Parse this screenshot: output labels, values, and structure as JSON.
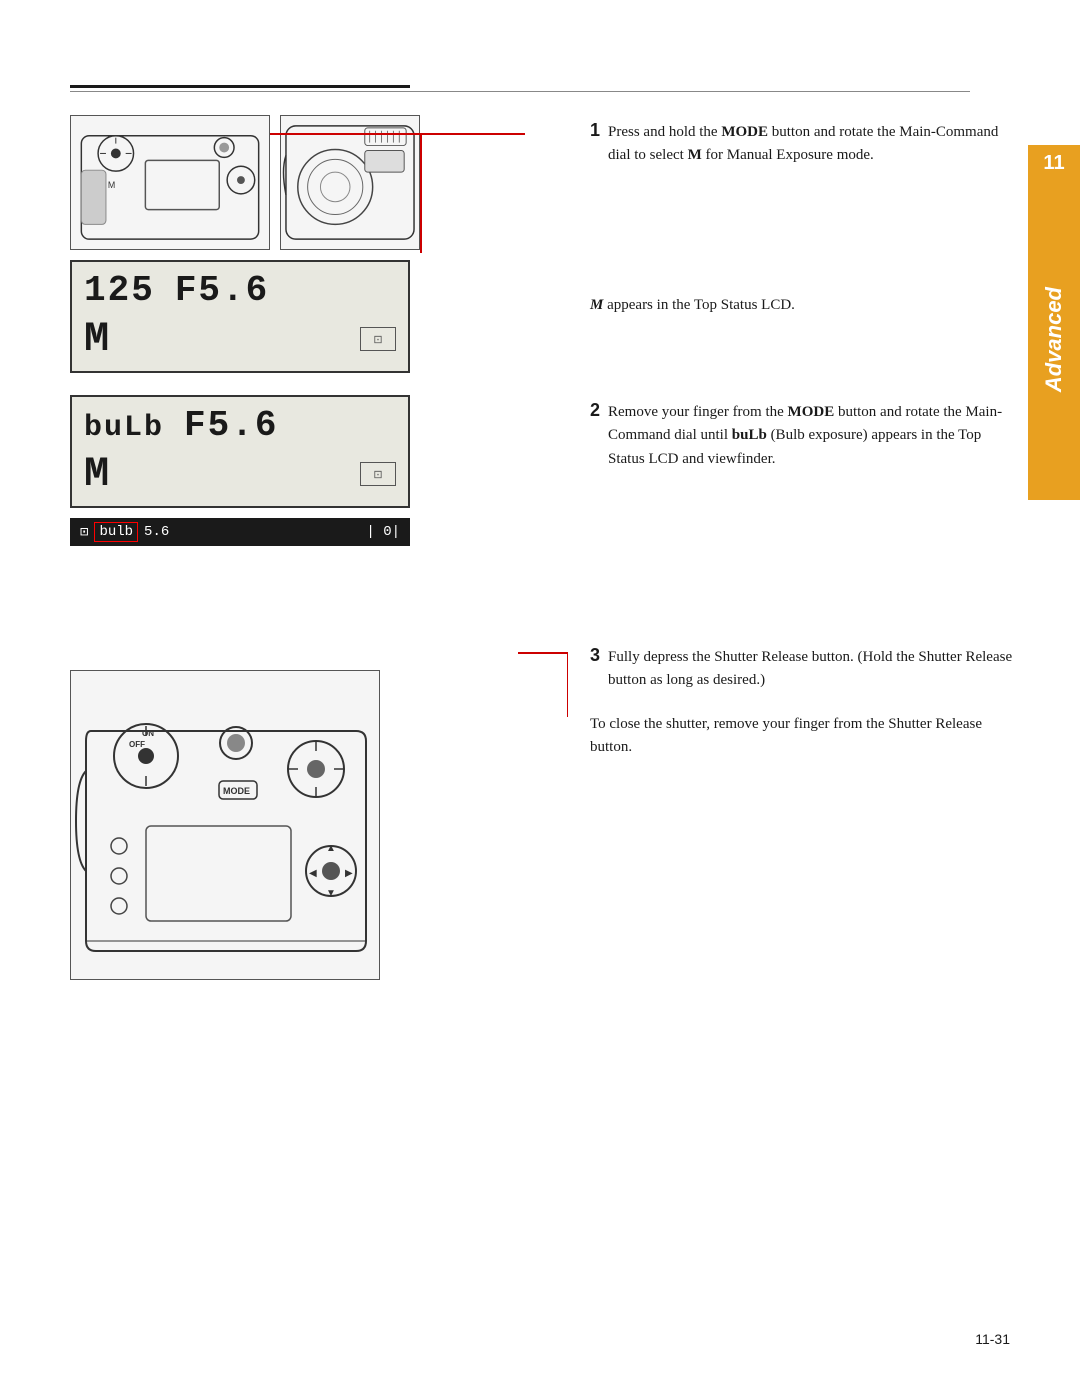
{
  "page": {
    "number": "11-31",
    "chapter_number": "11",
    "chapter_label": "Advanced"
  },
  "step1": {
    "number": "1",
    "text_line1": "Press and hold the ",
    "text_bold1": "MODE",
    "text_line2": "button and rotate the Main-Command dial to select ",
    "text_bold2": "M",
    "text_line3": " for Manual Exposure mode.",
    "lcd_note_italic": "M",
    "lcd_note_rest": " appears in the Top Status LCD.",
    "lcd_top_left": "125",
    "lcd_top_right": "F5.6",
    "lcd_bottom_m": "M"
  },
  "step2": {
    "number": "2",
    "text_line1": "Remove your finger from the ",
    "text_bold1": "MODE",
    "text_line2": " button and rotate the Main-Command dial until ",
    "text_bold2": "buLb",
    "text_line3": " (Bulb exposure) appears in the Top Status LCD and viewfinder.",
    "lcd_top_left": "buLb",
    "lcd_top_right": "F5.6",
    "lcd_bottom_m": "M",
    "viewfinder_prefix": "⊡",
    "viewfinder_bulb": "bulb",
    "viewfinder_mid": "5.6",
    "viewfinder_end": "| 0|"
  },
  "step3": {
    "number": "3",
    "text_line1": "Fully depress the Shutter Release button. (Hold the Shutter Release button as long as desired.)",
    "text_line2": "To close the shutter, remove your finger from the Shutter Release button."
  },
  "lines": {
    "top_thick_color": "#1a1a1a",
    "top_thin_color": "#888888",
    "red_color": "#cc0000",
    "tab_color": "#e8a020"
  }
}
